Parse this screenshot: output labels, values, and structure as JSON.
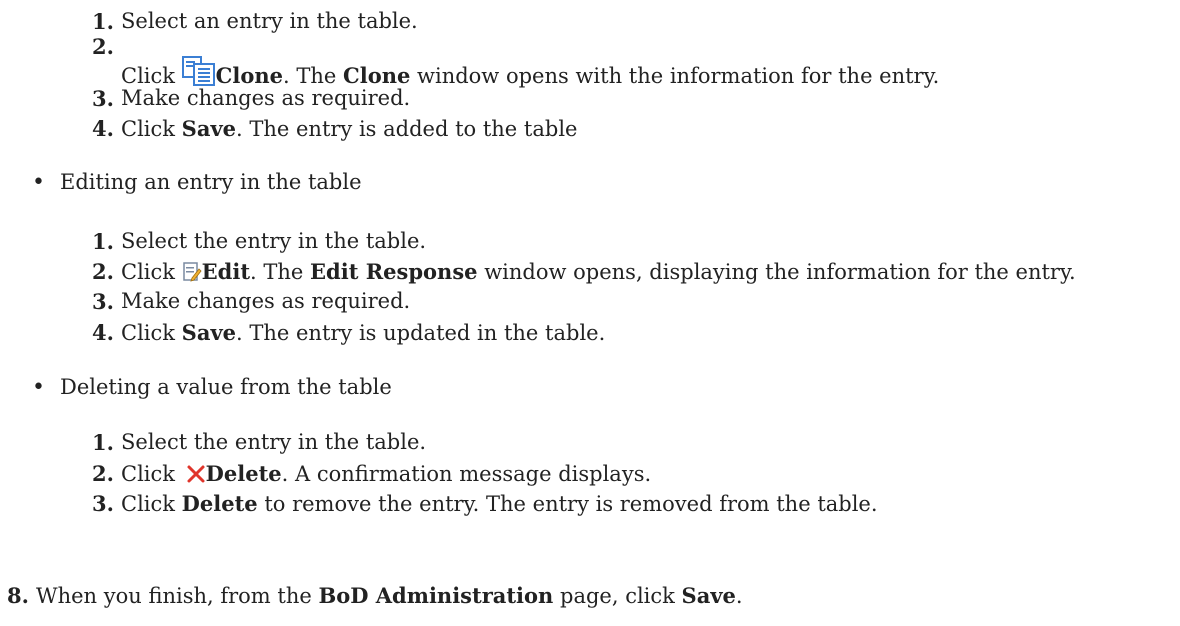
{
  "clone_steps": [
    {
      "num": "1.",
      "text": "Select an entry in the table."
    },
    {
      "num": "2.",
      "pre": "Click ",
      "bold1": "Clone",
      "mid1": ". The ",
      "bold2": "Clone",
      "post": " window opens with the information for the entry."
    },
    {
      "num": "3.",
      "text": "Make changes as required."
    },
    {
      "num": "4.",
      "pre": "Click ",
      "bold1": "Save",
      "post": ". The entry is added to the table"
    }
  ],
  "edit_section": {
    "bullet": "•",
    "heading": "Editing an entry in the table",
    "steps": [
      {
        "num": "1.",
        "text": "Select the entry in the table."
      },
      {
        "num": "2.",
        "pre": "Click ",
        "bold1": "Edit",
        "mid1": ". The ",
        "bold2": "Edit Response",
        "post": " window opens, displaying the information for the entry."
      },
      {
        "num": "3.",
        "text": "Make changes as required."
      },
      {
        "num": "4.",
        "pre": "Click ",
        "bold1": "Save",
        "post": ". The entry is updated in the table."
      }
    ]
  },
  "delete_section": {
    "bullet": "•",
    "heading": "Deleting a value from the table",
    "steps": [
      {
        "num": "1.",
        "text": "Select the entry in the table."
      },
      {
        "num": "2.",
        "pre": "Click ",
        "bold1": "Delete",
        "post": ". A confirmation message displays."
      },
      {
        "num": "3.",
        "pre": "Click ",
        "bold1": "Delete",
        "post": " to remove the entry. The entry is removed from the table."
      }
    ]
  },
  "final_step": {
    "num": "8.",
    "pre": "When you finish, from the ",
    "bold1": "BoD Administration",
    "mid1": " page, click ",
    "bold2": "Save",
    "post": "."
  },
  "icons": {
    "clone": "clone-icon",
    "edit": "edit-icon",
    "delete": "delete-icon"
  },
  "colors": {
    "text": "#222222",
    "delete_icon": "#e0352b",
    "clone_icon": "#3b7fd4"
  }
}
